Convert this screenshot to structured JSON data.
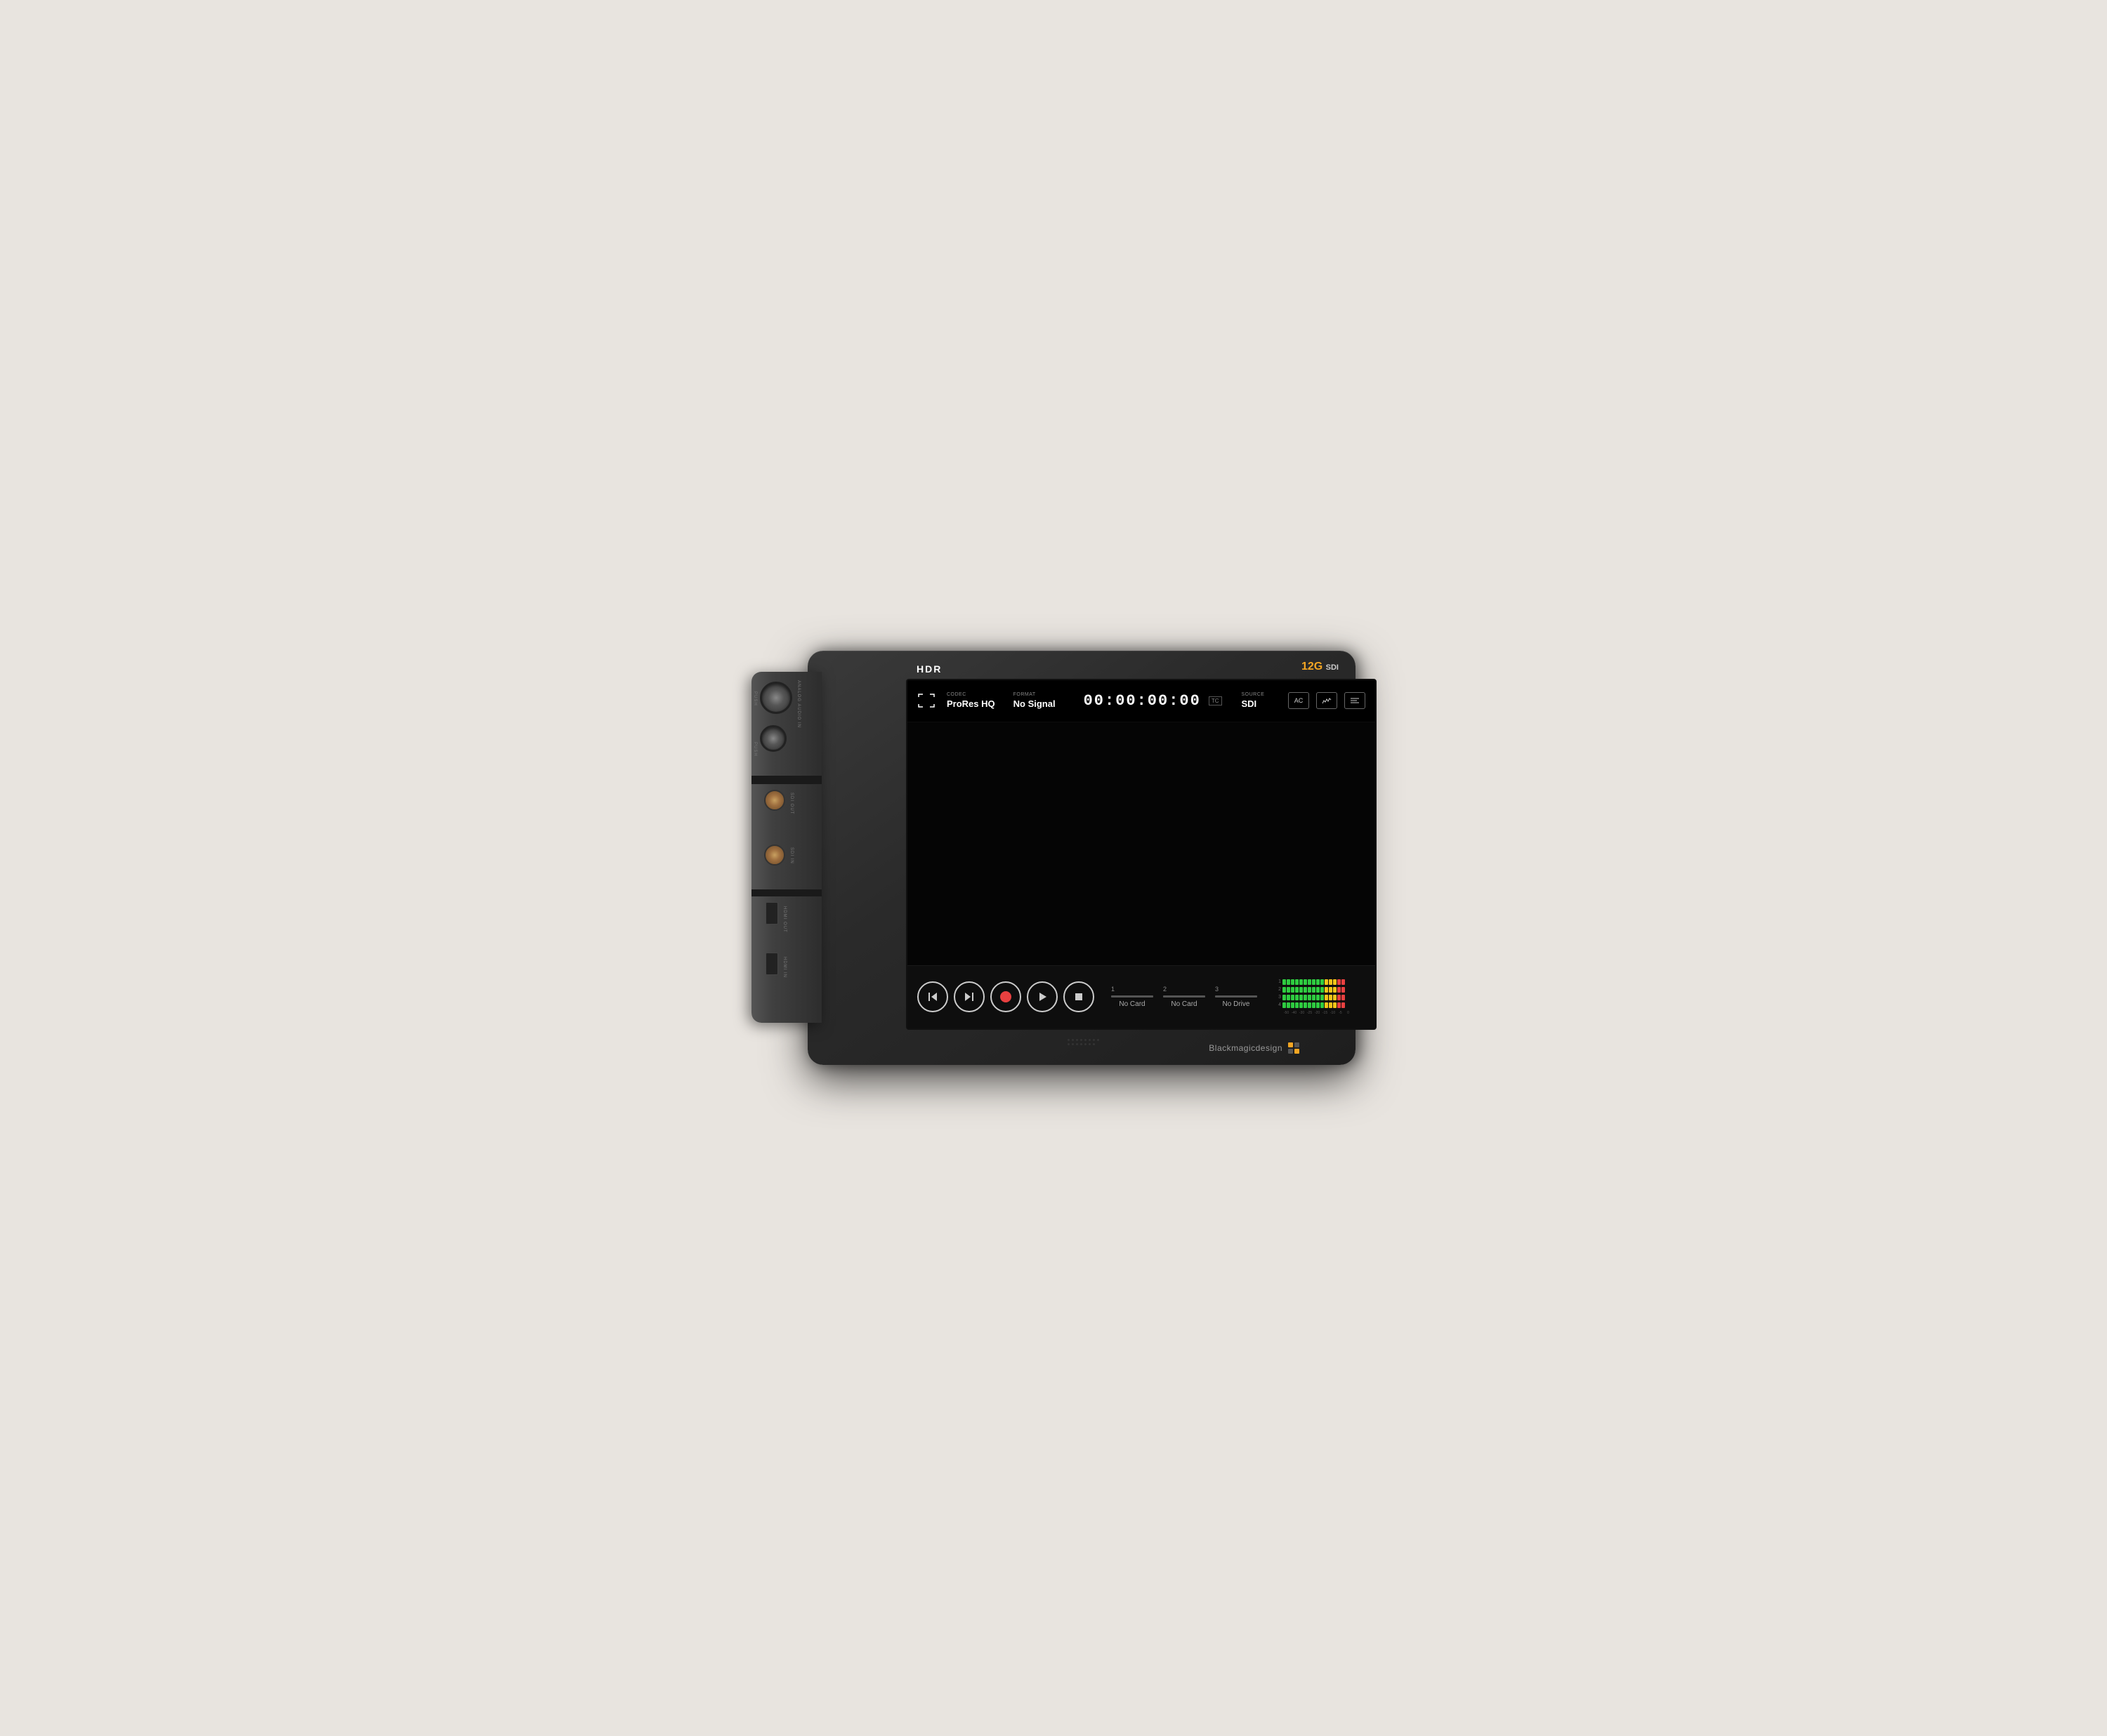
{
  "device": {
    "model_badge": "12G",
    "model_suffix": "SDI",
    "hdr_label": "HDR",
    "brand": "Blackmagicdesign"
  },
  "hud": {
    "codec_label": "CODEC",
    "codec_value": "ProRes HQ",
    "format_label": "FORMAT",
    "format_value": "No Signal",
    "timecode": "00:00:00:00",
    "tc_badge": "TC",
    "source_label": "SOURCE",
    "source_value": "SDI",
    "btn_ac": "AC",
    "btn_scope": "∿",
    "btn_settings": "≡"
  },
  "transport": {
    "skip_back": "⏮",
    "skip_forward": "⏭",
    "record": "●",
    "play": "▶",
    "stop": "■"
  },
  "storage": {
    "slots": [
      {
        "number": "1",
        "label": "No Card"
      },
      {
        "number": "2",
        "label": "No Card"
      },
      {
        "number": "3",
        "label": "No Drive"
      }
    ]
  },
  "audio_meters": {
    "channels": [
      "1",
      "2",
      "3",
      "4"
    ],
    "scale_labels": [
      "-50",
      "-40",
      "-30",
      "-25",
      "-20",
      "-15",
      "-10",
      "-5",
      "0"
    ],
    "green_segments": 10,
    "yellow_segments": 3,
    "red_segments": 2
  },
  "connectors": {
    "analog_audio_label": "ANALOG AUDIO IN",
    "sdi_out_label": "SDI OUT",
    "sdi_in_label": "SDI IN",
    "hdmi_out_label": "HDMI OUT",
    "hdmi_in_label": "HDMI IN"
  }
}
